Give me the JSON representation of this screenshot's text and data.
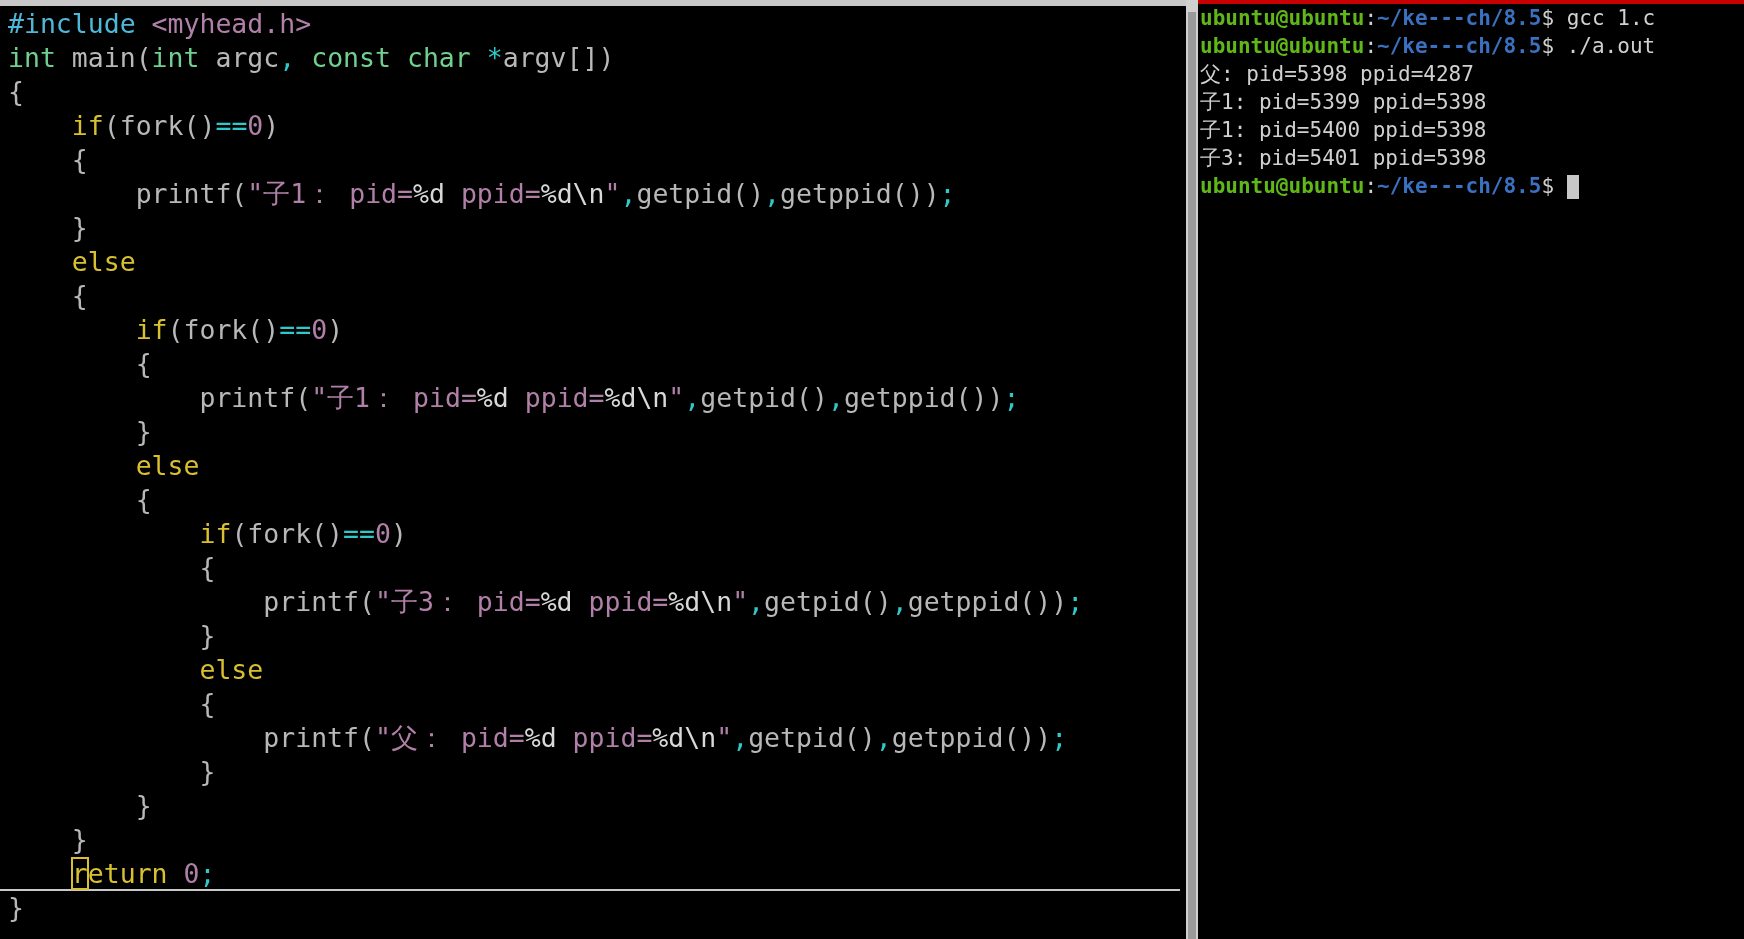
{
  "editor": {
    "lines": [
      {
        "current": false,
        "tokens": [
          {
            "text": "#include ",
            "kind": "preproc"
          },
          {
            "text": "<myhead.h>",
            "kind": "string"
          }
        ]
      },
      {
        "current": false,
        "tokens": [
          {
            "text": "int",
            "kind": "type"
          },
          {
            "text": " main(",
            "kind": "plain"
          },
          {
            "text": "int",
            "kind": "type"
          },
          {
            "text": " argc",
            "kind": "plain"
          },
          {
            "text": ",",
            "kind": "operator"
          },
          {
            "text": " const",
            "kind": "type"
          },
          {
            "text": " char",
            "kind": "type"
          },
          {
            "text": " *",
            "kind": "operator"
          },
          {
            "text": "argv[])",
            "kind": "plain"
          }
        ]
      },
      {
        "current": false,
        "tokens": [
          {
            "text": "{",
            "kind": "plain"
          }
        ]
      },
      {
        "current": false,
        "tokens": [
          {
            "text": "    if",
            "kind": "keyword"
          },
          {
            "text": "(fork()",
            "kind": "plain"
          },
          {
            "text": "==",
            "kind": "operator"
          },
          {
            "text": "0",
            "kind": "number"
          },
          {
            "text": ")",
            "kind": "plain"
          }
        ]
      },
      {
        "current": false,
        "tokens": [
          {
            "text": "    {",
            "kind": "plain"
          }
        ]
      },
      {
        "current": false,
        "tokens": [
          {
            "text": "        printf(",
            "kind": "plain"
          },
          {
            "text": "\"子1：",
            "kind": "string"
          },
          {
            "text": " pid=",
            "kind": "string"
          },
          {
            "text": "%d",
            "kind": "special"
          },
          {
            "text": " ppid=",
            "kind": "string"
          },
          {
            "text": "%d\\n",
            "kind": "special"
          },
          {
            "text": "\"",
            "kind": "string"
          },
          {
            "text": ",",
            "kind": "operator"
          },
          {
            "text": "getpid()",
            "kind": "plain"
          },
          {
            "text": ",",
            "kind": "operator"
          },
          {
            "text": "getppid())",
            "kind": "plain"
          },
          {
            "text": ";",
            "kind": "operator"
          }
        ]
      },
      {
        "current": false,
        "tokens": [
          {
            "text": "    }",
            "kind": "plain"
          }
        ]
      },
      {
        "current": false,
        "tokens": [
          {
            "text": "    else",
            "kind": "keyword"
          }
        ]
      },
      {
        "current": false,
        "tokens": [
          {
            "text": "    {",
            "kind": "plain"
          }
        ]
      },
      {
        "current": false,
        "tokens": [
          {
            "text": "        if",
            "kind": "keyword"
          },
          {
            "text": "(fork()",
            "kind": "plain"
          },
          {
            "text": "==",
            "kind": "operator"
          },
          {
            "text": "0",
            "kind": "number"
          },
          {
            "text": ")",
            "kind": "plain"
          }
        ]
      },
      {
        "current": false,
        "tokens": [
          {
            "text": "        {",
            "kind": "plain"
          }
        ]
      },
      {
        "current": false,
        "tokens": [
          {
            "text": "            printf(",
            "kind": "plain"
          },
          {
            "text": "\"子1：",
            "kind": "string"
          },
          {
            "text": " pid=",
            "kind": "string"
          },
          {
            "text": "%d",
            "kind": "special"
          },
          {
            "text": " ppid=",
            "kind": "string"
          },
          {
            "text": "%d\\n",
            "kind": "special"
          },
          {
            "text": "\"",
            "kind": "string"
          },
          {
            "text": ",",
            "kind": "operator"
          },
          {
            "text": "getpid()",
            "kind": "plain"
          },
          {
            "text": ",",
            "kind": "operator"
          },
          {
            "text": "getppid())",
            "kind": "plain"
          },
          {
            "text": ";",
            "kind": "operator"
          }
        ]
      },
      {
        "current": false,
        "tokens": [
          {
            "text": "        }",
            "kind": "plain"
          }
        ]
      },
      {
        "current": false,
        "tokens": [
          {
            "text": "        else",
            "kind": "keyword"
          }
        ]
      },
      {
        "current": false,
        "tokens": [
          {
            "text": "        {",
            "kind": "plain"
          }
        ]
      },
      {
        "current": false,
        "tokens": [
          {
            "text": "            if",
            "kind": "keyword"
          },
          {
            "text": "(fork()",
            "kind": "plain"
          },
          {
            "text": "==",
            "kind": "operator"
          },
          {
            "text": "0",
            "kind": "number"
          },
          {
            "text": ")",
            "kind": "plain"
          }
        ]
      },
      {
        "current": false,
        "tokens": [
          {
            "text": "            {",
            "kind": "plain"
          }
        ]
      },
      {
        "current": false,
        "tokens": [
          {
            "text": "                printf(",
            "kind": "plain"
          },
          {
            "text": "\"子3：",
            "kind": "string"
          },
          {
            "text": " pid=",
            "kind": "string"
          },
          {
            "text": "%d",
            "kind": "special"
          },
          {
            "text": " ppid=",
            "kind": "string"
          },
          {
            "text": "%d\\n",
            "kind": "special"
          },
          {
            "text": "\"",
            "kind": "string"
          },
          {
            "text": ",",
            "kind": "operator"
          },
          {
            "text": "getpid()",
            "kind": "plain"
          },
          {
            "text": ",",
            "kind": "operator"
          },
          {
            "text": "getppid())",
            "kind": "plain"
          },
          {
            "text": ";",
            "kind": "operator"
          }
        ]
      },
      {
        "current": false,
        "tokens": [
          {
            "text": "            }",
            "kind": "plain"
          }
        ]
      },
      {
        "current": false,
        "tokens": [
          {
            "text": "            else",
            "kind": "keyword"
          }
        ]
      },
      {
        "current": false,
        "tokens": [
          {
            "text": "            {",
            "kind": "plain"
          }
        ]
      },
      {
        "current": false,
        "tokens": [
          {
            "text": "                printf(",
            "kind": "plain"
          },
          {
            "text": "\"父：",
            "kind": "string"
          },
          {
            "text": " pid=",
            "kind": "string"
          },
          {
            "text": "%d",
            "kind": "special"
          },
          {
            "text": " ppid=",
            "kind": "string"
          },
          {
            "text": "%d\\n",
            "kind": "special"
          },
          {
            "text": "\"",
            "kind": "string"
          },
          {
            "text": ",",
            "kind": "operator"
          },
          {
            "text": "getpid()",
            "kind": "plain"
          },
          {
            "text": ",",
            "kind": "operator"
          },
          {
            "text": "getppid())",
            "kind": "plain"
          },
          {
            "text": ";",
            "kind": "operator"
          }
        ]
      },
      {
        "current": false,
        "tokens": [
          {
            "text": "            }",
            "kind": "plain"
          }
        ]
      },
      {
        "current": false,
        "tokens": [
          {
            "text": "        }",
            "kind": "plain"
          }
        ]
      },
      {
        "current": false,
        "tokens": [
          {
            "text": "    }",
            "kind": "plain"
          }
        ]
      },
      {
        "current": true,
        "tokens": [
          {
            "text": "    r",
            "kind": "keyword",
            "cursor": true
          },
          {
            "text": "eturn",
            "kind": "keyword"
          },
          {
            "text": " 0",
            "kind": "number"
          },
          {
            "text": ";",
            "kind": "operator"
          }
        ]
      },
      {
        "current": false,
        "tokens": [
          {
            "text": "}",
            "kind": "plain"
          }
        ]
      }
    ]
  },
  "terminal": {
    "lines": [
      {
        "cursor": false,
        "tokens": [
          {
            "text": "ubuntu@ubuntu",
            "kind": "user"
          },
          {
            "text": ":",
            "kind": "plain"
          },
          {
            "text": "~/ke---ch/8.5",
            "kind": "path"
          },
          {
            "text": "$ gcc 1.c",
            "kind": "plain"
          }
        ]
      },
      {
        "cursor": false,
        "tokens": [
          {
            "text": "ubuntu@ubuntu",
            "kind": "user"
          },
          {
            "text": ":",
            "kind": "plain"
          },
          {
            "text": "~/ke---ch/8.5",
            "kind": "path"
          },
          {
            "text": "$ ./a.out",
            "kind": "plain"
          }
        ]
      },
      {
        "cursor": false,
        "tokens": [
          {
            "text": "父: pid=5398 ppid=4287",
            "kind": "plain"
          }
        ]
      },
      {
        "cursor": false,
        "tokens": [
          {
            "text": "子1: pid=5399 ppid=5398",
            "kind": "plain"
          }
        ]
      },
      {
        "cursor": false,
        "tokens": [
          {
            "text": "子1: pid=5400 ppid=5398",
            "kind": "plain"
          }
        ]
      },
      {
        "cursor": false,
        "tokens": [
          {
            "text": "子3: pid=5401 ppid=5398",
            "kind": "plain"
          }
        ]
      },
      {
        "cursor": true,
        "tokens": [
          {
            "text": "ubuntu@ubuntu",
            "kind": "user"
          },
          {
            "text": ":",
            "kind": "plain"
          },
          {
            "text": "~/ke---ch/8.5",
            "kind": "path"
          },
          {
            "text": "$",
            "kind": "plain"
          }
        ]
      }
    ]
  }
}
